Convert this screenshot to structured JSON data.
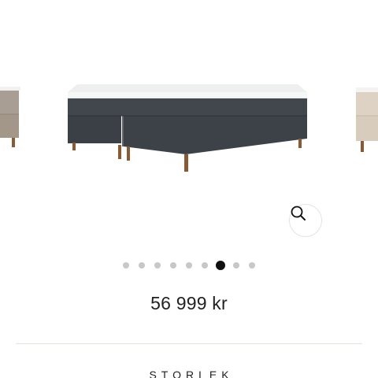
{
  "product": {
    "price": "56 999 kr",
    "size_label": "STORLEK"
  },
  "gallery": {
    "slide_count": 9,
    "active_index": 6,
    "zoom_icon": "magnifier-icon",
    "colors": {
      "main_bed_fabric": "#3e4449",
      "left_bed_fabric": "#a99e93",
      "right_bed_fabric": "#ddd2c4",
      "mattress_topper": "#f2f4f3",
      "legs": "#8a5a33",
      "active_dot": "#111111",
      "inactive_dot": "#c8c8c8"
    }
  }
}
